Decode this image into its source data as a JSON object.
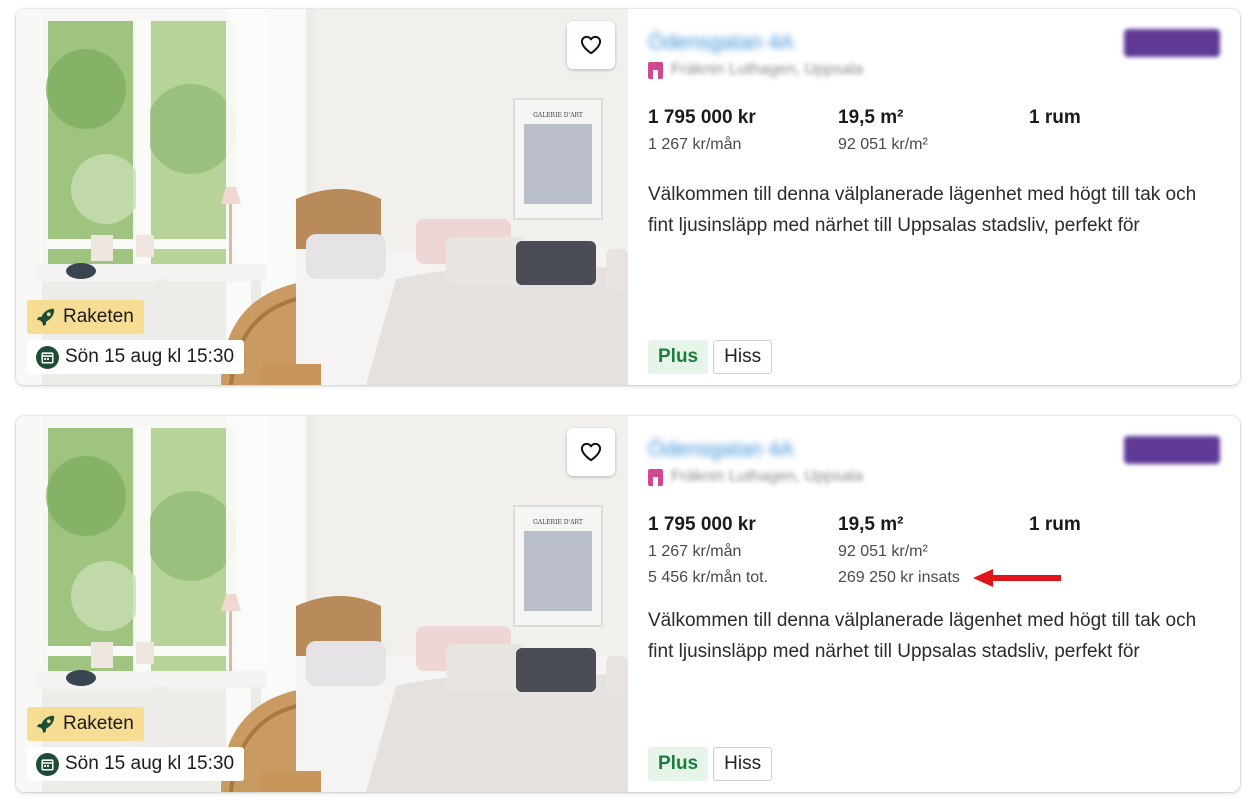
{
  "listings": [
    {
      "address": "Ödensgatan 4A",
      "area": "Fräknin Luthagen, Uppsala",
      "badge_raketen": "Raketen",
      "viewing": "Sön 15 aug kl 15:30",
      "price": "1 795 000 kr",
      "fee": "1 267 kr/mån",
      "size": "19,5 m²",
      "price_per_m2": "92 051 kr/m²",
      "rooms": "1 rum",
      "description": "Välkommen till denna välplanerade lägenhet med högt till tak och fint ljusinsläpp med närhet till Uppsalas stadsliv, perfekt för",
      "tags": [
        "Plus",
        "Hiss"
      ]
    },
    {
      "address": "Ödensgatan 4A",
      "area": "Fräknin Luthagen, Uppsala",
      "badge_raketen": "Raketen",
      "viewing": "Sön 15 aug kl 15:30",
      "price": "1 795 000 kr",
      "fee": "1 267 kr/mån",
      "total_cost": "5 456 kr/mån tot.",
      "size": "19,5 m²",
      "price_per_m2": "92 051 kr/m²",
      "insats": "269 250 kr insats",
      "rooms": "1 rum",
      "description": "Välkommen till denna välplanerade lägenhet med högt till tak och fint ljusinsläpp med närhet till Uppsalas stadsliv, perfekt för",
      "tags": [
        "Plus",
        "Hiss"
      ]
    }
  ],
  "colors": {
    "plus_bg": "#e6f4ea",
    "plus_text": "#17803d",
    "raketen_bg": "#f7dc93",
    "calendar_icon": "#1e4d36",
    "annotation_arrow": "#e0141b",
    "premium_pill": "#5e3a96"
  },
  "icons": [
    "heart-icon",
    "rocket-icon",
    "calendar-icon",
    "area-pin-icon",
    "annotation-arrow"
  ]
}
